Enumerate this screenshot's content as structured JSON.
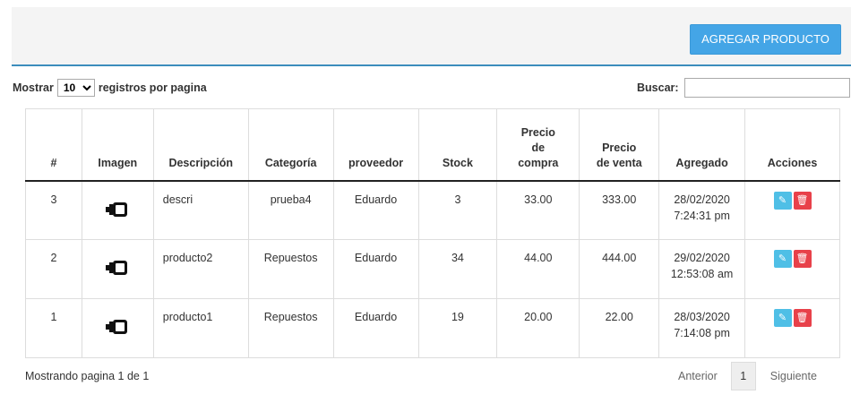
{
  "header": {
    "add_button": "AGREGAR PRODUCTO"
  },
  "controls": {
    "show_label": "Mostrar",
    "page_size": "10",
    "per_page_label": "registros por pagina",
    "search_label": "Buscar:",
    "search_value": ""
  },
  "table": {
    "columns": [
      "#",
      "Imagen",
      "Descripción",
      "Categoría",
      "proveedor",
      "Stock",
      "Precio de compra",
      "Precio de venta",
      "Agregado",
      "Acciones"
    ],
    "column_lines": {
      "buy": [
        "Precio",
        "de",
        "compra"
      ],
      "sell": [
        "Precio",
        "de venta"
      ]
    },
    "rows": [
      {
        "id": "3",
        "description": "descri",
        "category": "prueba4",
        "provider": "Eduardo",
        "stock": "3",
        "buy": "33.00",
        "sell": "333.00",
        "date": "28/02/2020",
        "time": "7:24:31 pm"
      },
      {
        "id": "2",
        "description": "producto2",
        "category": "Repuestos",
        "provider": "Eduardo",
        "stock": "34",
        "buy": "44.00",
        "sell": "444.00",
        "date": "29/02/2020",
        "time": "12:53:08 am"
      },
      {
        "id": "1",
        "description": "producto1",
        "category": "Repuestos",
        "provider": "Eduardo",
        "stock": "19",
        "buy": "20.00",
        "sell": "22.00",
        "date": "28/03/2020",
        "time": "7:14:08 pm"
      }
    ]
  },
  "footer": {
    "info": "Mostrando pagina 1 de 1",
    "prev": "Anterior",
    "page": "1",
    "next": "Siguiente"
  },
  "icons": {
    "edit": "edit-icon",
    "delete": "trash-icon",
    "product": "product-image"
  }
}
